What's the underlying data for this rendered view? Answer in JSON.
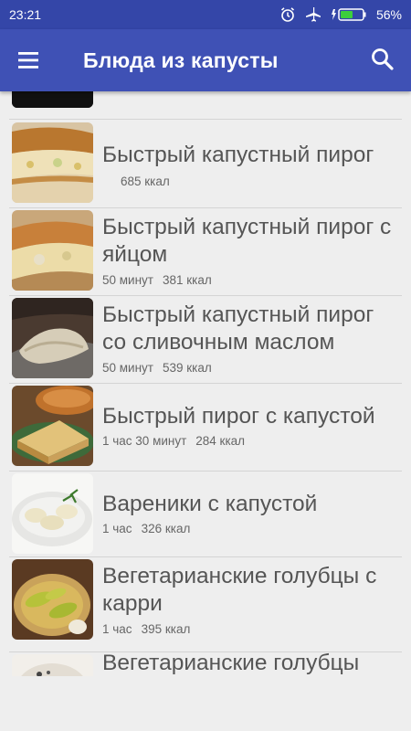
{
  "status_bar": {
    "time": "23:21",
    "battery": "56%"
  },
  "app_bar": {
    "title": "Блюда из капусты",
    "menu_icon": "menu-icon",
    "search_icon": "search-icon"
  },
  "colors": {
    "app_bar": "#3f51b5",
    "status_bar": "#3446a8",
    "background": "#eeeeee"
  },
  "recipes": [
    {
      "title": "",
      "time": "",
      "kcal": ""
    },
    {
      "title": "Быстрый капустный пирог",
      "time": "",
      "kcal": "685 ккал"
    },
    {
      "title": "Быстрый капустный пирог с яйцом",
      "time": "50 минут",
      "kcal": "381 ккал"
    },
    {
      "title": "Быстрый капустный пирог со сливочным маслом",
      "time": "50 минут",
      "kcal": "539 ккал"
    },
    {
      "title": "Быстрый пирог с капустой",
      "time": "1 час 30 минут",
      "kcal": "284 ккал"
    },
    {
      "title": "Вареники с капустой",
      "time": "1 час",
      "kcal": "326 ккал"
    },
    {
      "title": "Вегетарианские голубцы с карри",
      "time": "1 час",
      "kcal": "395 ккал"
    },
    {
      "title": "Вегетарианские голубцы",
      "time": "",
      "kcal": ""
    }
  ]
}
